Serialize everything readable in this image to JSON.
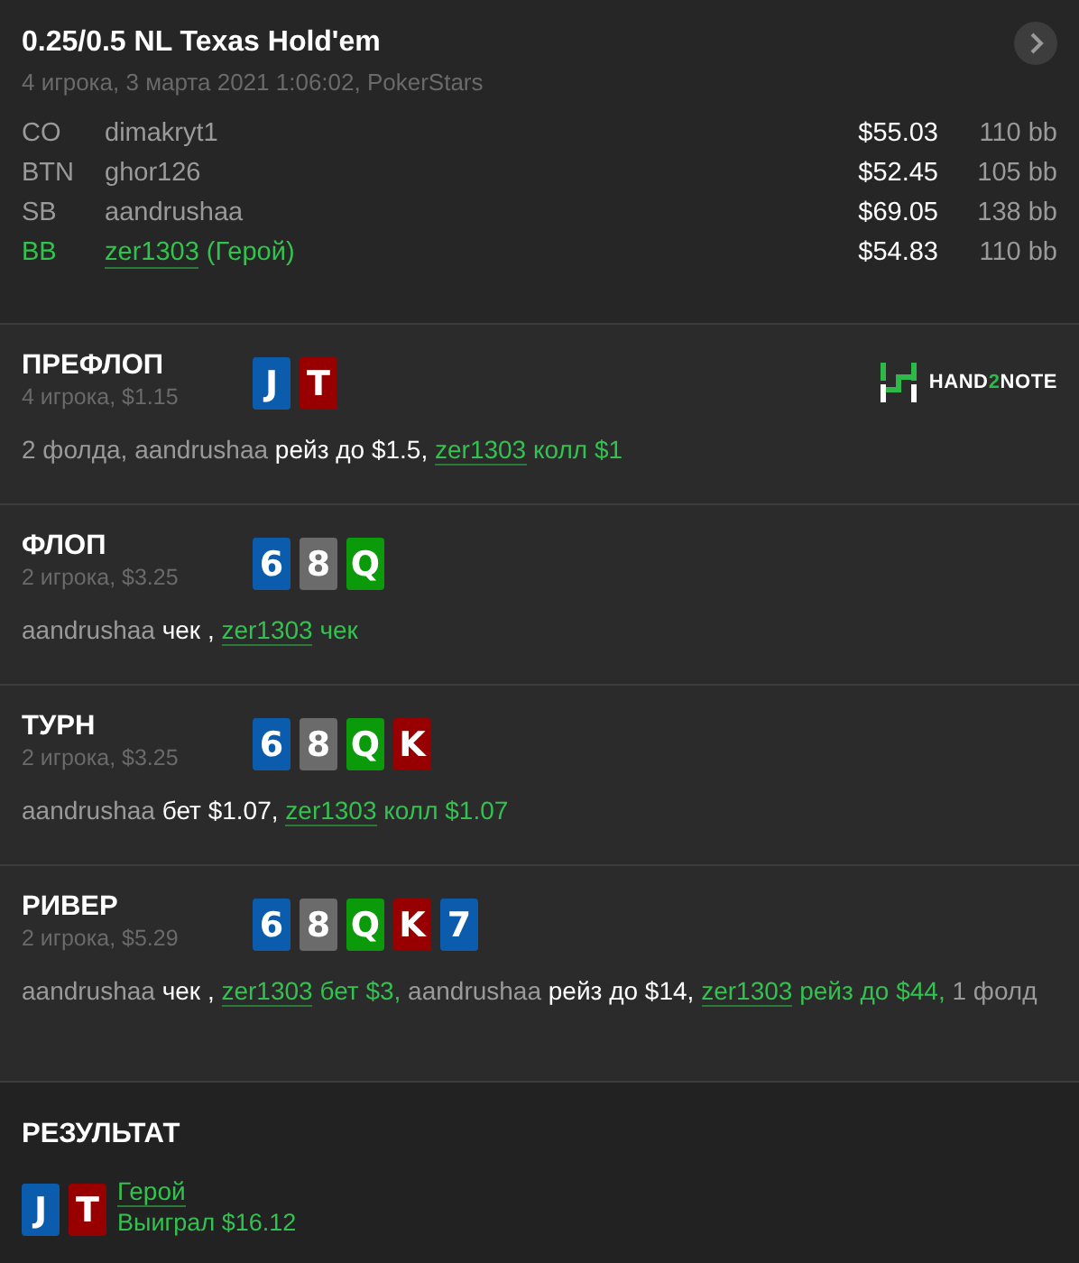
{
  "header": {
    "title": "0.25/0.5 NL Texas Hold'em",
    "subtitle": "4 игрока, 3 марта 2021 1:06:02, PokerStars"
  },
  "players": [
    {
      "position": "CO",
      "name": "dimakryt1",
      "stack": "$55.03",
      "bb": "110 bb",
      "hero": false
    },
    {
      "position": "BTN",
      "name": "ghor126",
      "stack": "$52.45",
      "bb": "105 bb",
      "hero": false
    },
    {
      "position": "SB",
      "name": "aandrushaa",
      "stack": "$69.05",
      "bb": "138 bb",
      "hero": false
    },
    {
      "position": "BB",
      "name": "zer1303",
      "hero_label": "(Герой)",
      "stack": "$54.83",
      "bb": "110 bb",
      "hero": true
    }
  ],
  "logo": {
    "before": "HAND",
    "accent": "2",
    "after": "NOTE"
  },
  "streets": [
    {
      "title": "ПРЕФЛОП",
      "info": "4 игрока, $1.15",
      "logo": true,
      "cards": [
        {
          "rank": "J",
          "color": "#0b5cad"
        },
        {
          "rank": "T",
          "color": "#980000"
        }
      ],
      "actions": [
        {
          "kind": "player",
          "text": "2 фолда, aandrushaa"
        },
        {
          "kind": "action",
          "text": "рейз до $1.5,"
        },
        {
          "kind": "hero",
          "text": "zer1303"
        },
        {
          "kind": "hero_action",
          "text": "колл $1"
        }
      ]
    },
    {
      "title": "ФЛОП",
      "info": "2 игрока, $3.25",
      "logo": false,
      "cards": [
        {
          "rank": "6",
          "color": "#0b5cad"
        },
        {
          "rank": "8",
          "color": "#6b6b6b"
        },
        {
          "rank": "Q",
          "color": "#0a9a0a"
        }
      ],
      "actions": [
        {
          "kind": "player",
          "text": "aandrushaa"
        },
        {
          "kind": "action",
          "text": "чек ,"
        },
        {
          "kind": "hero",
          "text": "zer1303"
        },
        {
          "kind": "hero_action",
          "text": "чек"
        }
      ]
    },
    {
      "title": "ТУРН",
      "info": "2 игрока, $3.25",
      "logo": false,
      "cards": [
        {
          "rank": "6",
          "color": "#0b5cad"
        },
        {
          "rank": "8",
          "color": "#6b6b6b"
        },
        {
          "rank": "Q",
          "color": "#0a9a0a"
        },
        {
          "rank": "K",
          "color": "#980000"
        }
      ],
      "actions": [
        {
          "kind": "player",
          "text": "aandrushaa"
        },
        {
          "kind": "action",
          "text": "бет $1.07,"
        },
        {
          "kind": "hero",
          "text": "zer1303"
        },
        {
          "kind": "hero_action",
          "text": "колл $1.07"
        }
      ]
    },
    {
      "title": "РИВЕР",
      "info": "2 игрока, $5.29",
      "logo": false,
      "cards": [
        {
          "rank": "6",
          "color": "#0b5cad"
        },
        {
          "rank": "8",
          "color": "#6b6b6b"
        },
        {
          "rank": "Q",
          "color": "#0a9a0a"
        },
        {
          "rank": "K",
          "color": "#980000"
        },
        {
          "rank": "7",
          "color": "#0b5cad"
        }
      ],
      "actions": [
        {
          "kind": "player",
          "text": "aandrushaa"
        },
        {
          "kind": "action",
          "text": "чек ,"
        },
        {
          "kind": "hero",
          "text": "zer1303"
        },
        {
          "kind": "hero_action",
          "text": "бет $3,"
        },
        {
          "kind": "player",
          "text": "aandrushaa"
        },
        {
          "kind": "action",
          "text": "рейз до $14,"
        },
        {
          "kind": "hero",
          "text": "zer1303"
        },
        {
          "kind": "hero_action",
          "text": "рейз до $44,"
        },
        {
          "kind": "player",
          "text": "1 фолд"
        }
      ]
    }
  ],
  "result": {
    "title": "РЕЗУЛЬТАТ",
    "cards": [
      {
        "rank": "J",
        "color": "#0b5cad"
      },
      {
        "rank": "T",
        "color": "#980000"
      }
    ],
    "name": "Герой",
    "outcome": "Выиграл $16.12"
  }
}
